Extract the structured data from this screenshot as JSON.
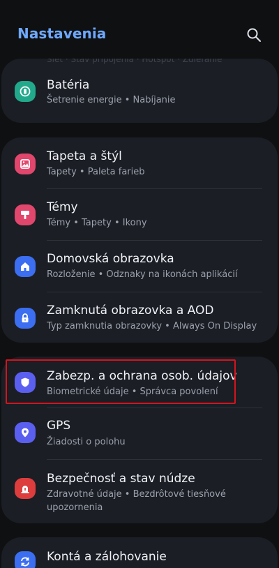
{
  "header": {
    "title": "Nastavenia",
    "search_icon": "search-icon"
  },
  "top_card": {
    "partial_text": "Sieť · Stav pripojenia · Hotspot · Zdieľanie"
  },
  "battery_card": {
    "items": [
      {
        "title": "Batéria",
        "subtitle": "Šetrenie energie  •  Nabíjanie",
        "icon": "battery-icon",
        "color": "#22a98c"
      }
    ]
  },
  "personal_card": {
    "items": [
      {
        "title": "Tapeta a štýl",
        "subtitle": "Tapety  •  Paleta farieb",
        "icon": "wallpaper-icon",
        "color": "#e1466c"
      },
      {
        "title": "Témy",
        "subtitle": "Témy  •  Tapety  •  Ikony",
        "icon": "themes-icon",
        "color": "#e1466c"
      },
      {
        "title": "Domovská obrazovka",
        "subtitle": "Rozloženie  •  Odznaky na ikonách aplikácií",
        "icon": "home-icon",
        "color": "#3b6ef0"
      },
      {
        "title": "Zamknutá obrazovka a AOD",
        "subtitle": "Typ zamknutia obrazovky  •  Always On Display",
        "icon": "lock-icon",
        "color": "#3b6ef0"
      }
    ]
  },
  "security_card": {
    "items": [
      {
        "title": "Zabezp. a ochrana osob. údajov",
        "subtitle": "Biometrické údaje  •  Správca povolení",
        "icon": "shield-icon",
        "color": "#5b5ff0"
      },
      {
        "title": "GPS",
        "subtitle": "Žiadosti o polohu",
        "icon": "location-pin-icon",
        "color": "#5b5ff0"
      },
      {
        "title": "Bezpečnosť a stav núdze",
        "subtitle": "Zdravotné údaje  •  Bezdrôtové tiesňové upozornenia",
        "icon": "emergency-icon",
        "color": "#dd3d3d"
      }
    ]
  },
  "accounts_card": {
    "items": [
      {
        "title": "Kontá a zálohovanie",
        "icon": "sync-icon",
        "color": "#3b6ef0"
      }
    ]
  }
}
